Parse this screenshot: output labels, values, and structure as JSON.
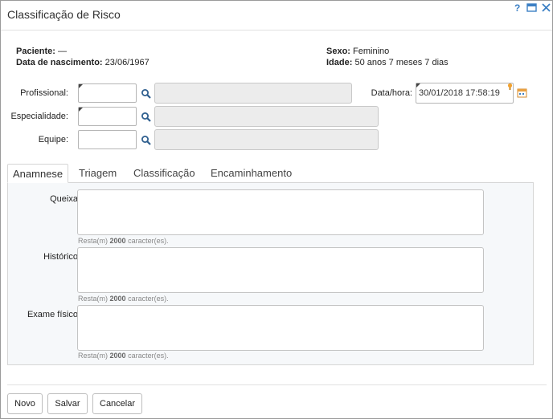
{
  "window": {
    "title": "Classificação de Risco"
  },
  "patient": {
    "name_label": "Paciente:",
    "name_value": "—",
    "birth_label": "Data de nascimento:",
    "birth_value": "23/06/1967",
    "sex_label": "Sexo:",
    "sex_value": "Feminino",
    "age_label": "Idade:",
    "age_value": "50 anos 7 meses 7 dias"
  },
  "form": {
    "profissional_label": "Profissional:",
    "especialidade_label": "Especialidade:",
    "equipe_label": "Equipe:",
    "datetime_label": "Data/hora:",
    "datetime_value": "30/01/2018 17:58:19"
  },
  "tabs": [
    {
      "label": "Anamnese",
      "active": true
    },
    {
      "label": "Triagem",
      "active": false
    },
    {
      "label": "Classificação",
      "active": false
    },
    {
      "label": "Encaminhamento",
      "active": false
    }
  ],
  "anamnese": {
    "fields": [
      {
        "label": "Queixa:"
      },
      {
        "label": "Histórico:"
      },
      {
        "label": "Exame físico:"
      }
    ],
    "hint_prefix": "Resta(m)",
    "hint_count": "2000",
    "hint_suffix": "caracter(es)."
  },
  "buttons": {
    "new": "Novo",
    "save": "Salvar",
    "cancel": "Cancelar"
  },
  "icons": {
    "help": "help-icon",
    "maximize": "maximize-icon",
    "close": "close-icon",
    "search": "magnifier-icon",
    "calendar": "calendar-icon",
    "clock": "clock-icon"
  },
  "colors": {
    "accent": "#3b7fc4",
    "readonly_bg": "#ececec"
  }
}
